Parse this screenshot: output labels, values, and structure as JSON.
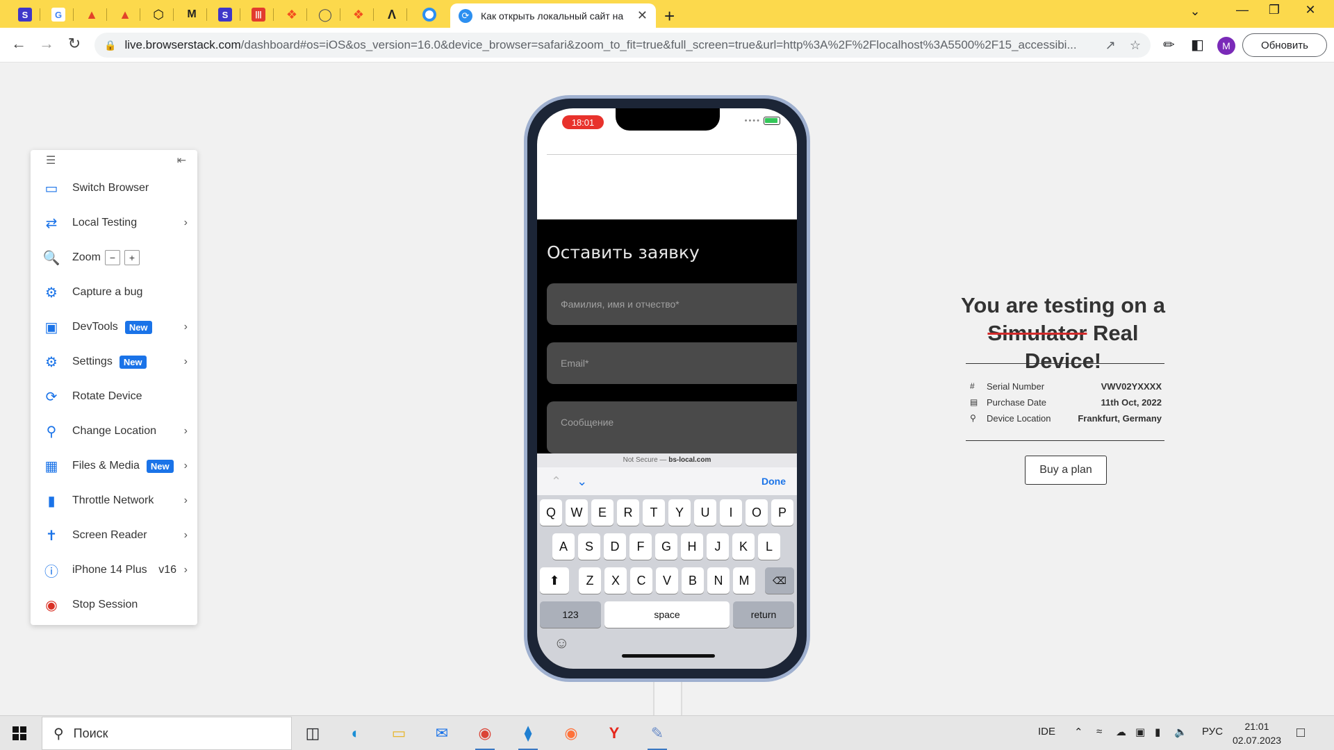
{
  "browser": {
    "tabs": [
      {
        "icon": "S",
        "color": "#3f37c9"
      },
      {
        "icon": "G",
        "color": "#ffffff"
      },
      {
        "icon": "gitlab",
        "color": "#e24329"
      },
      {
        "icon": "gitlab",
        "color": "#e24329"
      },
      {
        "icon": "codepen",
        "color": "#111111"
      },
      {
        "icon": "M",
        "color": "#222222"
      },
      {
        "icon": "S",
        "color": "#3f37c9"
      },
      {
        "icon": "bars",
        "color": "#e23b2e"
      },
      {
        "icon": "figma",
        "color": "#f24e1e"
      },
      {
        "icon": "globe",
        "color": "#555555"
      },
      {
        "icon": "figma",
        "color": "#f24e1e"
      },
      {
        "icon": "arrow",
        "color": "#222222"
      },
      {
        "icon": "chrome",
        "color": "#2c8ff0"
      }
    ],
    "active_tab_title": "Как открыть локальный сайт на",
    "url_host": "live.browserstack.com",
    "url_rest": "/dashboard#os=iOS&os_version=16.0&device_browser=safari&zoom_to_fit=true&full_screen=true&url=http%3A%2F%2Flocalhost%3A5500%2F15_accessibi...",
    "profile_initial": "M",
    "update_label": "Обновить"
  },
  "panel": {
    "items": [
      {
        "label": "Switch Browser"
      },
      {
        "label": "Local Testing"
      },
      {
        "label": "Zoom"
      },
      {
        "label": "Capture a bug"
      },
      {
        "label": "DevTools",
        "badge": "New"
      },
      {
        "label": "Settings",
        "badge": "New"
      },
      {
        "label": "Rotate Device"
      },
      {
        "label": "Change Location"
      },
      {
        "label": "Files & Media",
        "badge": "New"
      },
      {
        "label": "Throttle Network"
      },
      {
        "label": "Screen Reader"
      },
      {
        "label": "iPhone 14 Plus",
        "version": "v16"
      },
      {
        "label": "Stop Session"
      }
    ]
  },
  "phone": {
    "time": "18:01",
    "form_title": "Оставить заявку",
    "placeholders": {
      "name": "Фамилия, имя и отчество*",
      "email": "Email*",
      "message": "Сообщение"
    },
    "url_strip_prefix": "Not Secure — ",
    "url_strip_host": "bs-local.com",
    "done_label": "Done",
    "keys_row1": [
      "Q",
      "W",
      "E",
      "R",
      "T",
      "Y",
      "U",
      "I",
      "O",
      "P"
    ],
    "keys_row2": [
      "A",
      "S",
      "D",
      "F",
      "G",
      "H",
      "J",
      "K",
      "L"
    ],
    "keys_row3": [
      "Z",
      "X",
      "C",
      "V",
      "B",
      "N",
      "M"
    ],
    "key_123": "123",
    "key_space": "space",
    "key_return": "return"
  },
  "info": {
    "heading_line1": "You are testing on a",
    "heading_struck": "Simulator",
    "heading_rest": "Real Device!",
    "rows": [
      {
        "label": "Serial Number",
        "value": "VWV02YXXXX"
      },
      {
        "label": "Purchase Date",
        "value": "11th Oct, 2022"
      },
      {
        "label": "Device Location",
        "value": "Frankfurt, Germany"
      }
    ],
    "buy_label": "Buy a plan"
  },
  "taskbar": {
    "search_placeholder": "Поиск",
    "tray_ide": "IDE",
    "tray_lang": "РУС",
    "time": "21:01",
    "date": "02.07.2023"
  }
}
